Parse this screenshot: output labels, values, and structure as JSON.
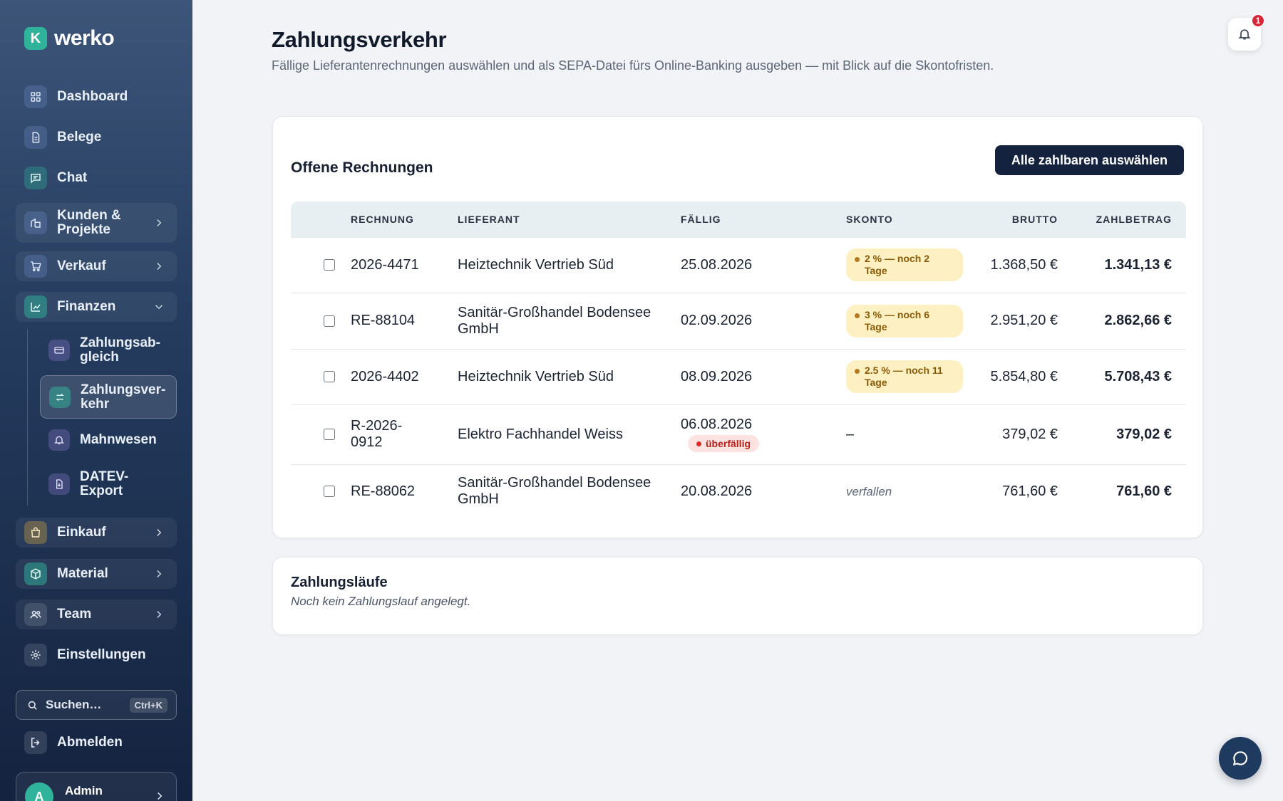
{
  "app": {
    "logo_letter": "K",
    "name": "werko"
  },
  "sidebar": {
    "items": [
      {
        "label": "Dashboard",
        "icon": "grid-icon"
      },
      {
        "label": "Belege",
        "icon": "document-icon"
      },
      {
        "label": "Chat",
        "icon": "chat-icon"
      },
      {
        "label": "Kunden & Projekte",
        "label_lines": [
          "Kunden &",
          "Projekte"
        ],
        "icon": "building-icon",
        "expandable": true
      },
      {
        "label": "Verkauf",
        "icon": "cart-icon",
        "expandable": true
      },
      {
        "label": "Finanzen",
        "icon": "chart-icon",
        "expanded": true
      },
      {
        "label": "Einkauf",
        "icon": "bag-icon",
        "expandable": true
      },
      {
        "label": "Material",
        "icon": "box-icon",
        "expandable": true
      },
      {
        "label": "Team",
        "icon": "users-icon",
        "expandable": true
      },
      {
        "label": "Einstellungen",
        "icon": "gear-icon"
      }
    ],
    "finanzen_sub": [
      {
        "label_lines": [
          "Zahlungsab-",
          "gleich"
        ],
        "icon": "card-icon"
      },
      {
        "label_lines": [
          "Zahlungsver-",
          "kehr"
        ],
        "icon": "transfer-icon",
        "active": true
      },
      {
        "label_lines": [
          "Mahnwesen"
        ],
        "icon": "bell-icon"
      },
      {
        "label_lines": [
          "DATEV-",
          "Export"
        ],
        "icon": "export-icon"
      }
    ],
    "search": {
      "label": "Suchen…",
      "shortcut": "Ctrl+K"
    },
    "logout": "Abmelden",
    "user": {
      "initial": "A",
      "name": "Admin"
    }
  },
  "header": {
    "title": "Zahlungsverkehr",
    "subtitle": "Fällige Lieferantenrechnungen auswählen und als SEPA-Datei fürs Online-Banking ausgeben — mit Blick auf die Skontofristen.",
    "notifications_count": "1"
  },
  "invoices": {
    "title": "Offene Rechnungen",
    "select_all_label": "Alle zahlbaren auswählen",
    "columns": [
      "RECHNUNG",
      "LIEFERANT",
      "FÄLLIG",
      "SKONTO",
      "BRUTTO",
      "ZAHLBETRAG"
    ],
    "rows": [
      {
        "invoice": "2026-4471",
        "supplier": "Heiztechnik Vertrieb Süd",
        "due": "25.08.2026",
        "skonto": "2 % — noch 2 Tage",
        "gross": "1.368,50 €",
        "amount": "1.341,13 €"
      },
      {
        "invoice": "RE-88104",
        "supplier": "Sanitär-Großhandel Bodensee GmbH",
        "due": "02.09.2026",
        "skonto": "3 % — noch 6 Tage",
        "gross": "2.951,20 €",
        "amount": "2.862,66 €"
      },
      {
        "invoice": "2026-4402",
        "supplier": "Heiztechnik Vertrieb Süd",
        "due": "08.09.2026",
        "skonto": "2.5 % — noch 11 Tage",
        "gross": "5.854,80 €",
        "amount": "5.708,43 €"
      },
      {
        "invoice": "R-2026-0912",
        "supplier": "Elektro Fachhandel Weiss",
        "due": "06.08.2026",
        "due_badge": "überfällig",
        "skonto_text": "–",
        "gross": "379,02 €",
        "amount": "379,02 €"
      },
      {
        "invoice": "RE-88062",
        "supplier": "Sanitär-Großhandel Bodensee GmbH",
        "due": "20.08.2026",
        "skonto_text": "verfallen",
        "gross": "761,60 €",
        "amount": "761,60 €"
      }
    ]
  },
  "payment_runs": {
    "title": "Zahlungsläufe",
    "empty_text": "Noch kein Zahlungslauf angelegt."
  },
  "colors": {
    "sidebar_top": "#3c5578",
    "sidebar_bottom": "#14233f",
    "accent": "#2fb39a",
    "primary_button": "#15223d",
    "skonto_bg": "#fdf0c2",
    "overdue": "#d92d20"
  }
}
